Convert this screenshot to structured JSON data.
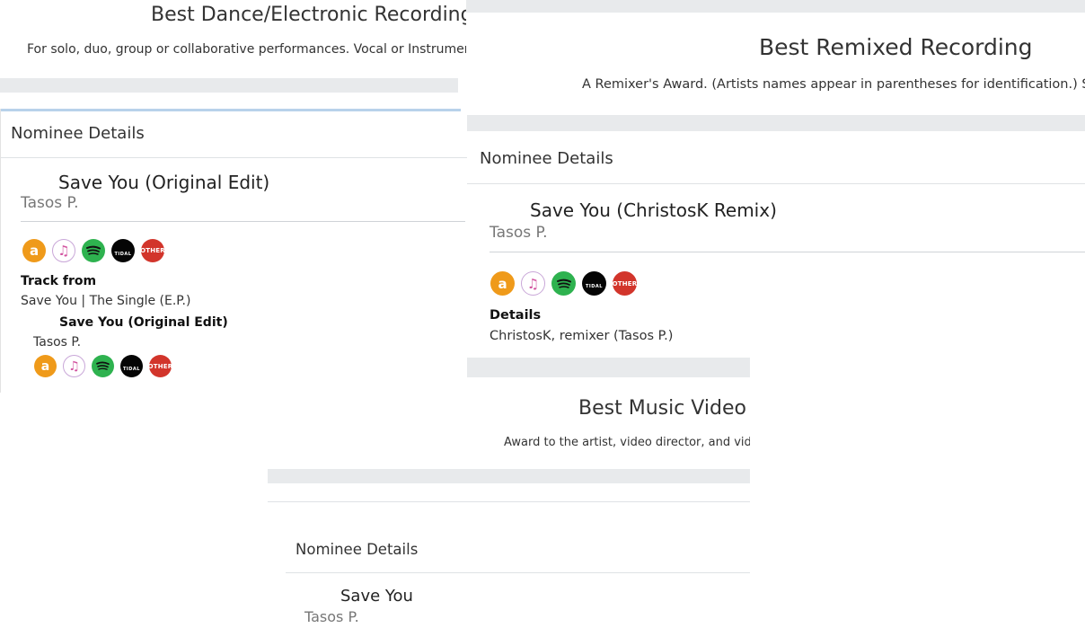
{
  "award1": {
    "title": "Best Dance/Electronic Recording",
    "description": "For solo, duo, group or collaborative performances. Vocal or Instrumental.",
    "nominee_header": "Nominee Details",
    "track_title": "Save You (Original Edit)",
    "artist": "Tasos P.",
    "track_from_label": "Track from",
    "track_from_value": "Save You | The Single (E.P.)",
    "sub_title": "Save You (Original Edit)",
    "sub_artist": "Tasos P."
  },
  "award2": {
    "title": "Best Remixed Recording",
    "description": "A Remixer's Award. (Artists names appear in parentheses for identification.) Singles",
    "nominee_header": "Nominee Details",
    "track_title": "Save You (ChristosK Remix)",
    "artist": "Tasos P.",
    "details_label": "Details",
    "details_value": "ChristosK, remixer (Tasos P.)"
  },
  "award3": {
    "title": "Best Music Video",
    "description": "Award to the artist, video director, and video",
    "nominee_header": "Nominee Details",
    "track_title": "Save You",
    "artist": "Tasos P."
  },
  "icons": {
    "amazon_glyph": "a",
    "itunes_glyph": "♫",
    "tidal_label": "TIDAL",
    "other_label": "OTHER"
  },
  "colors": {
    "amazon": "#ef9a1a",
    "itunes": "#d254a0",
    "spotify": "#2eb24f",
    "tidal": "#050505",
    "other": "#d2352b",
    "divider": "#e8eaec"
  }
}
